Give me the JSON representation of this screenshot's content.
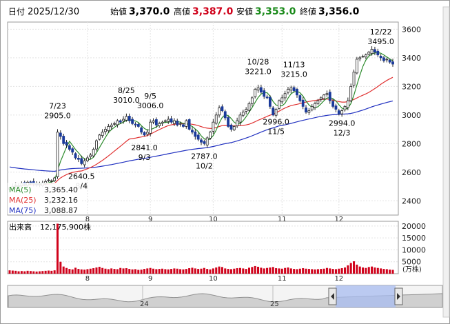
{
  "header": {
    "date_label": "日付",
    "date": "2025/12/30",
    "open_label": "始値",
    "open": "3,370.0",
    "high_label": "高値",
    "high": "3,387.0",
    "low_label": "安値",
    "low": "3,353.0",
    "close_label": "終値",
    "close": "3,356.0"
  },
  "colors": {
    "up": "#d0021b",
    "down": "#1a3a9a",
    "ma5": "#2a8a2a",
    "ma25": "#e03030",
    "ma75": "#2030c0",
    "volume": "#d0021b",
    "nav": "#8aa0e0"
  },
  "legend": [
    {
      "label": "MA(5)",
      "value": "3,365.40",
      "color": "#2a8a2a"
    },
    {
      "label": "MA(25)",
      "value": "3,232.16",
      "color": "#e03030"
    },
    {
      "label": "MA(75)",
      "value": "3,088.87",
      "color": "#2030c0"
    }
  ],
  "volume_label": "出来高",
  "volume_value": "12,175,900株",
  "volume_unit": "(万株)",
  "nav_labels": [
    "24",
    "25"
  ],
  "chart_data": [
    {
      "type": "candlestick",
      "y_ticks": [
        2400,
        2600,
        2800,
        3000,
        3200,
        3400,
        3600
      ],
      "ylim": [
        2300,
        3650
      ],
      "x_month_labels": [
        {
          "label": "8",
          "day": 26
        },
        {
          "label": "9",
          "day": 47
        },
        {
          "label": "10",
          "day": 68
        },
        {
          "label": "11",
          "day": 91
        },
        {
          "label": "12",
          "day": 110
        }
      ],
      "annotations": [
        {
          "label": "7/23",
          "value": "2905.0",
          "day": 16,
          "pos": "above"
        },
        {
          "label": "8/4",
          "value": "2640.5",
          "day": 24,
          "pos": "below"
        },
        {
          "label": "8/25",
          "value": "3010.0",
          "day": 39,
          "pos": "above"
        },
        {
          "label": "9/3",
          "value": "2841.0",
          "day": 45,
          "pos": "below"
        },
        {
          "label": "9/5",
          "value": "3006.0",
          "day": 47,
          "pos": "above"
        },
        {
          "label": "10/2",
          "value": "2787.0",
          "day": 65,
          "pos": "below"
        },
        {
          "label": "10/28",
          "value": "3221.0",
          "day": 83,
          "pos": "above"
        },
        {
          "label": "11/5",
          "value": "2996.0",
          "day": 89,
          "pos": "below"
        },
        {
          "label": "11/13",
          "value": "3215.0",
          "day": 95,
          "pos": "above"
        },
        {
          "label": "12/3",
          "value": "2994.0",
          "day": 111,
          "pos": "below"
        },
        {
          "label": "12/22",
          "value": "3495.0",
          "day": 124,
          "pos": "above"
        }
      ],
      "closes": [
        2490,
        2500,
        2510,
        2505,
        2520,
        2515,
        2530,
        2525,
        2520,
        2510,
        2515,
        2525,
        2535,
        2545,
        2540,
        2560,
        2880,
        2850,
        2800,
        2790,
        2760,
        2740,
        2700,
        2690,
        2660,
        2680,
        2700,
        2720,
        2760,
        2820,
        2860,
        2880,
        2900,
        2920,
        2930,
        2940,
        2960,
        2950,
        2970,
        2990,
        2960,
        2940,
        2930,
        2920,
        2880,
        2860,
        2880,
        2950,
        2960,
        2930,
        2940,
        2950,
        2960,
        2970,
        2950,
        2960,
        2930,
        2940,
        2920,
        2960,
        2900,
        2880,
        2850,
        2830,
        2810,
        2800,
        2840,
        2880,
        2950,
        3000,
        3050,
        3030,
        2980,
        2920,
        2900,
        2920,
        2960,
        3000,
        3020,
        3040,
        3080,
        3120,
        3180,
        3190,
        3160,
        3130,
        3120,
        3060,
        3000,
        3040,
        3100,
        3120,
        3150,
        3180,
        3190,
        3170,
        3140,
        3100,
        3060,
        3020,
        3030,
        3060,
        3080,
        3100,
        3120,
        3140,
        3150,
        3100,
        3060,
        3040,
        3010,
        3030,
        3060,
        3100,
        3200,
        3300,
        3390,
        3400,
        3410,
        3420,
        3440,
        3460,
        3440,
        3420,
        3400,
        3380,
        3390,
        3370,
        3356
      ]
    },
    {
      "type": "bar",
      "name": "出来高",
      "y_ticks": [
        5000,
        10000,
        15000,
        20000
      ],
      "ylim": [
        0,
        22000
      ],
      "values": [
        1400,
        1300,
        1200,
        1000,
        1100,
        1000,
        1200,
        1100,
        1000,
        900,
        1000,
        1100,
        1200,
        1300,
        1200,
        1400,
        21000,
        5000,
        3000,
        2400,
        2000,
        1800,
        2500,
        2000,
        1800,
        1700,
        1900,
        2100,
        2300,
        2600,
        2900,
        2400,
        2100,
        1900,
        2200,
        2000,
        1900,
        2400,
        2200,
        2300,
        2000,
        1800,
        1900,
        1600,
        1700,
        2000,
        2200,
        2400,
        2100,
        1900,
        2000,
        2100,
        1900,
        1800,
        2000,
        2200,
        2100,
        1900,
        1800,
        2000,
        2300,
        2500,
        2200,
        2000,
        2100,
        2400,
        2000,
        1800,
        2200,
        2600,
        3000,
        2800,
        2200,
        2000,
        1900,
        2100,
        2300,
        2400,
        2200,
        2000,
        2500,
        2800,
        3200,
        2900,
        2500,
        2200,
        2400,
        2600,
        2800,
        2300,
        2200,
        2100,
        2400,
        2600,
        2200,
        2000,
        1900,
        2100,
        2300,
        2100,
        2000,
        1900,
        1800,
        1900,
        2000,
        2100,
        2400,
        2200,
        2000,
        1900,
        2100,
        2300,
        2600,
        3500,
        4500,
        5200,
        3800,
        3000,
        2600,
        2400,
        2800,
        3000,
        2600,
        2400,
        2200,
        2000,
        1900,
        1700,
        1600
      ]
    }
  ]
}
